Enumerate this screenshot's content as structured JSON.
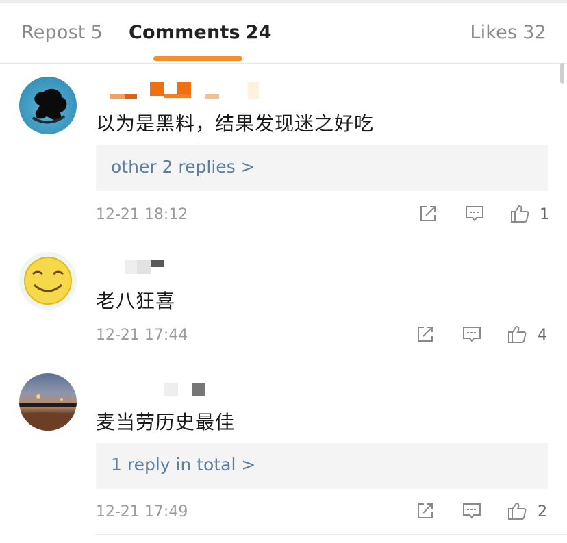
{
  "tabs": [
    {
      "label": "Repost",
      "count": "5"
    },
    {
      "label": "Comments",
      "count": "24"
    },
    {
      "label": "Likes",
      "count": "32"
    }
  ],
  "colors": {
    "accent": "#f3902a",
    "link": "#5b7f9e"
  },
  "comments": [
    {
      "text": "以为是黑料，结果发现迷之好吃",
      "replies_label": "other 2 replies >",
      "timestamp": "12-21 18:12",
      "like_count": "1"
    },
    {
      "text": "老八狂喜",
      "timestamp": "12-21 17:44",
      "like_count": "4"
    },
    {
      "text": "麦当劳历史最佳",
      "replies_label": "1 reply in total >",
      "timestamp": "12-21 17:49",
      "like_count": "2"
    }
  ],
  "icons": {
    "repost": "share-arrow-icon",
    "comment": "comment-bubble-icon",
    "like": "thumbs-up-icon"
  }
}
